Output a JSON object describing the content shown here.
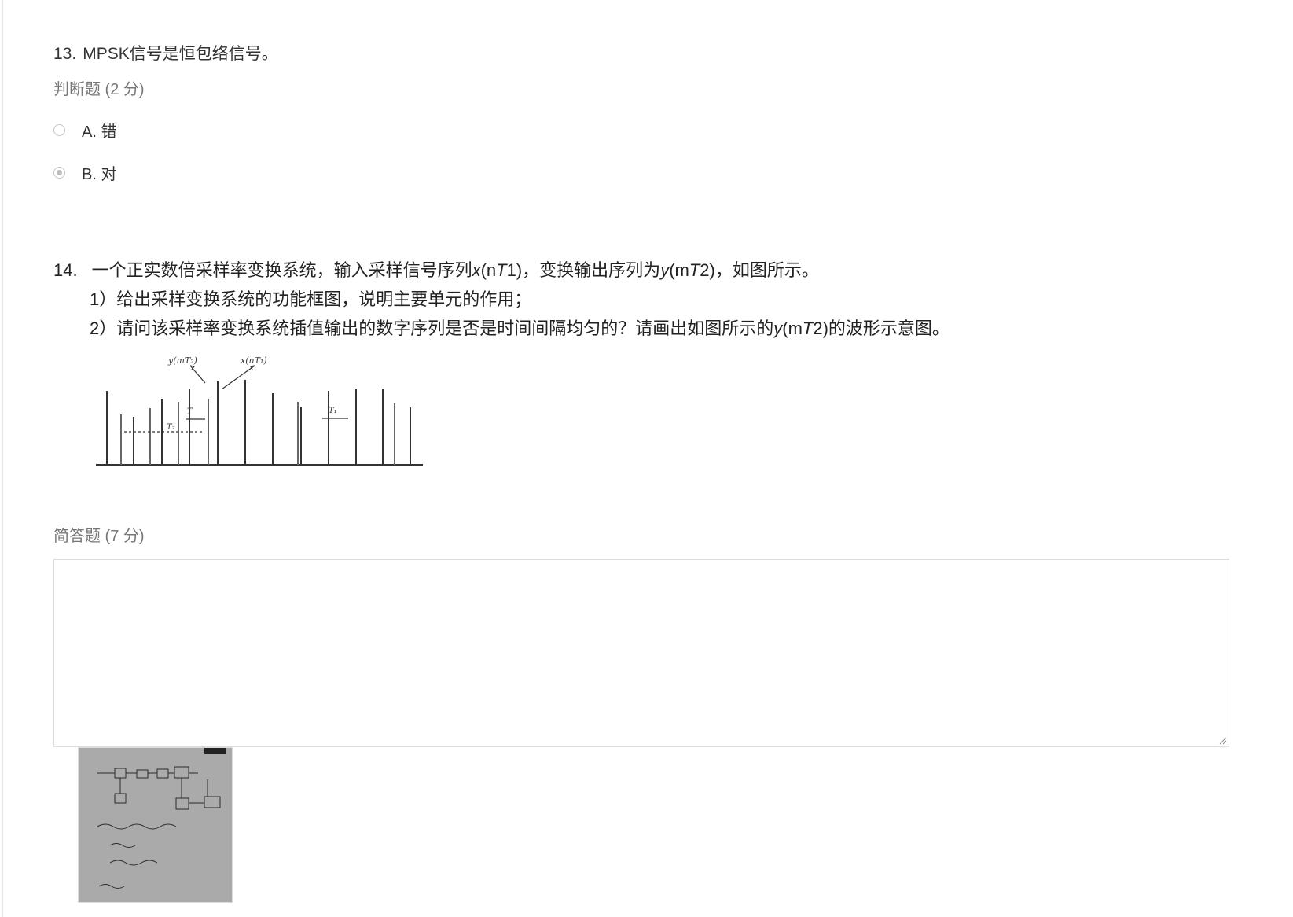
{
  "q13": {
    "number": "13.",
    "text": "MPSK信号是恒包络信号。",
    "type_label": "判断题 (2 分)",
    "options": [
      {
        "label": "A. 错",
        "checked": false
      },
      {
        "label": "B. 对",
        "checked": true
      }
    ]
  },
  "q14": {
    "number": "14.",
    "line1": {
      "a": "一个正实数倍采样率变换系统，输入采样信号序列",
      "b": "x",
      "c": "(n",
      "d": "T",
      "e": "1)，变换输出序列为",
      "f": "y",
      "g": "(m",
      "h": "T",
      "i": "2)，如图所示。"
    },
    "line2": "1）给出采样变换系统的功能框图，说明主要单元的作用；",
    "line3": {
      "a": "2）请问该采样率变换系统插值输出的数字序列是否是时间间隔均匀的？请画出如图所示的",
      "b": "y",
      "c": "(m",
      "d": "T",
      "e": "2)的波形示意图。"
    },
    "figure": {
      "label_y": "y(mT₂)",
      "label_x": "x(nT₁)",
      "label_t": "T",
      "label_t2": "T₂",
      "label_t1": "T₁"
    },
    "type_label": "简答题 (7 分)",
    "answer_value": "",
    "attachment_name": "handwritten-answer-photo"
  }
}
